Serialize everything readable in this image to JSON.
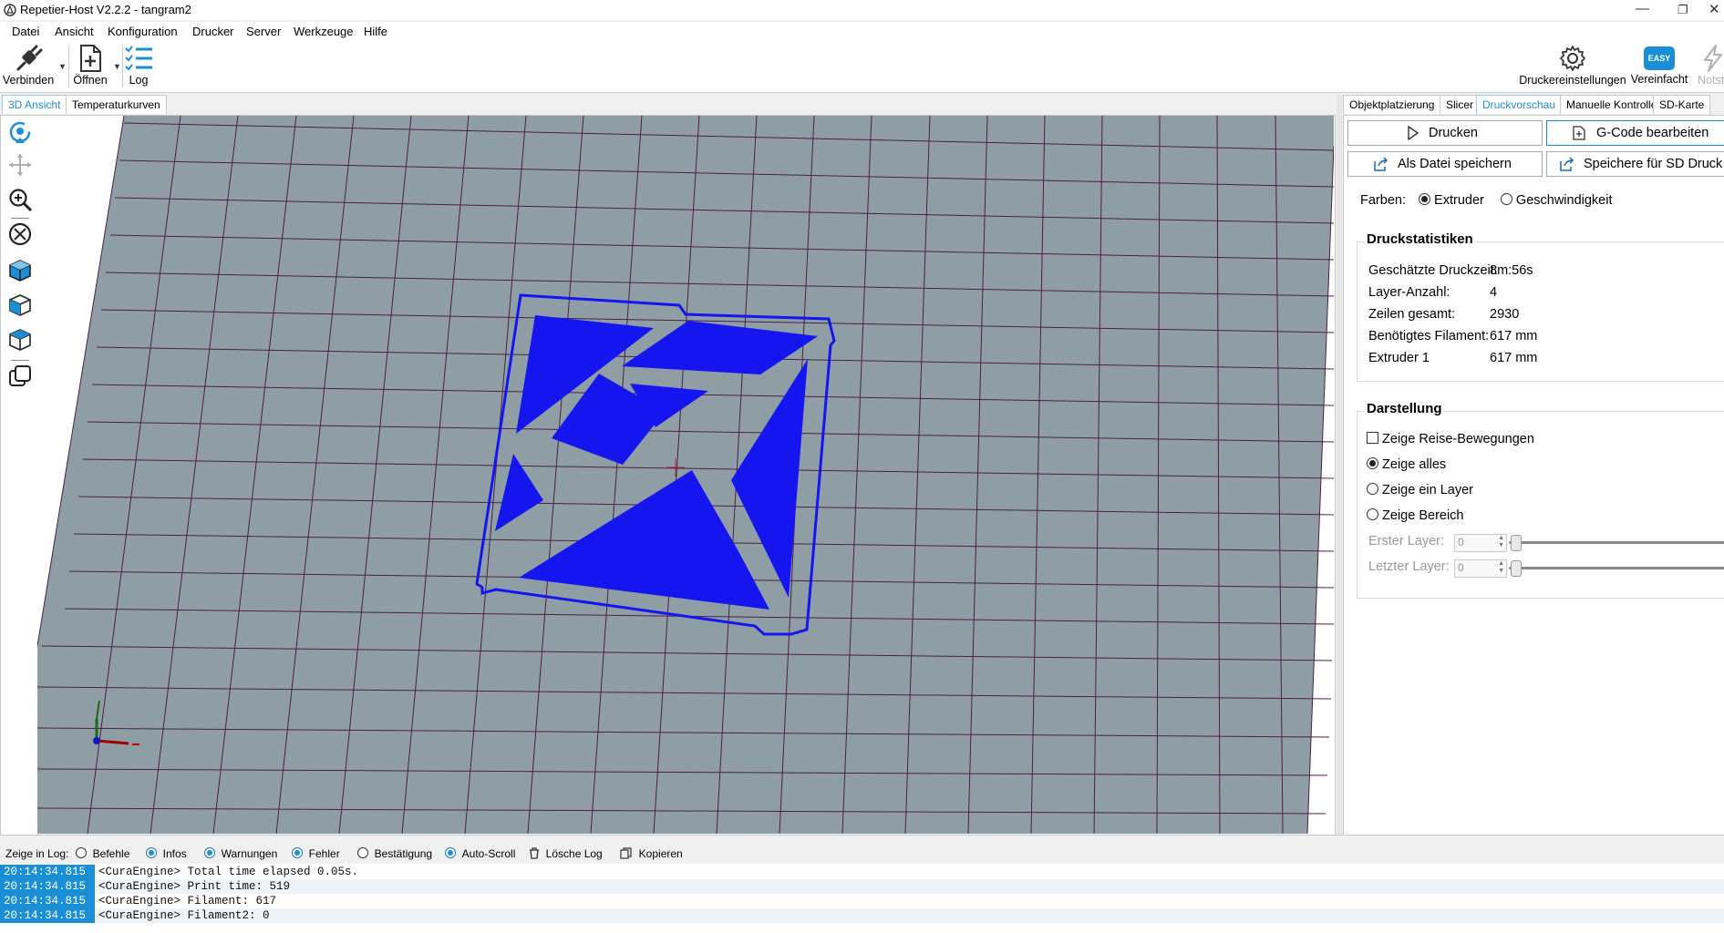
{
  "window": {
    "title": "Repetier-Host V2.2.2 - tangram2"
  },
  "menu": [
    "Datei",
    "Ansicht",
    "Konfiguration",
    "Drucker",
    "Server",
    "Werkzeuge",
    "Hilfe"
  ],
  "toolbar": {
    "connect": "Verbinden",
    "open": "Öffnen",
    "log": "Log",
    "printer_settings": "Druckereinstellungen",
    "easy_badge": "EASY",
    "easy": "Vereinfacht",
    "emergency": "Notst"
  },
  "left_tabs": [
    "3D Ansicht",
    "Temperaturkurven"
  ],
  "right_tabs": [
    "Objektplatzierung",
    "Slicer",
    "Druckvorschau",
    "Manuelle Kontrolle",
    "SD-Karte"
  ],
  "actions": {
    "print": "Drucken",
    "edit_gcode": "G-Code bearbeiten",
    "save_file": "Als Datei speichern",
    "save_sd": "Speichere für SD Druck"
  },
  "colors_row": {
    "label": "Farben:",
    "extruder": "Extruder",
    "speed": "Geschwindigkeit",
    "selected": "Extruder"
  },
  "stats": {
    "title": "Druckstatistiken",
    "rows": [
      {
        "label": "Geschätzte Druckzeit:",
        "value": "8m:56s"
      },
      {
        "label": "Layer-Anzahl:",
        "value": "4"
      },
      {
        "label": "Zeilen gesamt:",
        "value": "2930"
      },
      {
        "label": "Benötigtes Filament:",
        "value": "617 mm"
      },
      {
        "label": "Extruder 1",
        "value": "617 mm"
      }
    ]
  },
  "display": {
    "title": "Darstellung",
    "show_travel": "Zeige Reise-Bewegungen",
    "show_all": "Zeige alles",
    "show_one_layer": "Zeige ein Layer",
    "show_range": "Zeige Bereich",
    "first_layer_label": "Erster Layer:",
    "first_layer_value": "0",
    "last_layer_label": "Letzter Layer:",
    "last_layer_value": "0"
  },
  "log_bar": {
    "label": "Zeige in Log:",
    "commands": "Befehle",
    "infos": "Infos",
    "warnings": "Warnungen",
    "errors": "Fehler",
    "confirm": "Bestätigung",
    "autoscroll": "Auto-Scroll",
    "clear": "Lösche Log",
    "copy": "Kopieren"
  },
  "log": [
    {
      "time": "20:14:34.815",
      "msg": "<CuraEngine> Total time elapsed  0.05s."
    },
    {
      "time": "20:14:34.815",
      "msg": "<CuraEngine> Print time: 519"
    },
    {
      "time": "20:14:34.815",
      "msg": "<CuraEngine> Filament: 617"
    },
    {
      "time": "20:14:34.815",
      "msg": "<CuraEngine> Filament2: 0"
    }
  ],
  "colors": {
    "accent": "#1a8fd6",
    "print": "#1515f0",
    "bed": "#8f9ea5",
    "grid": "#4a1f4a"
  }
}
